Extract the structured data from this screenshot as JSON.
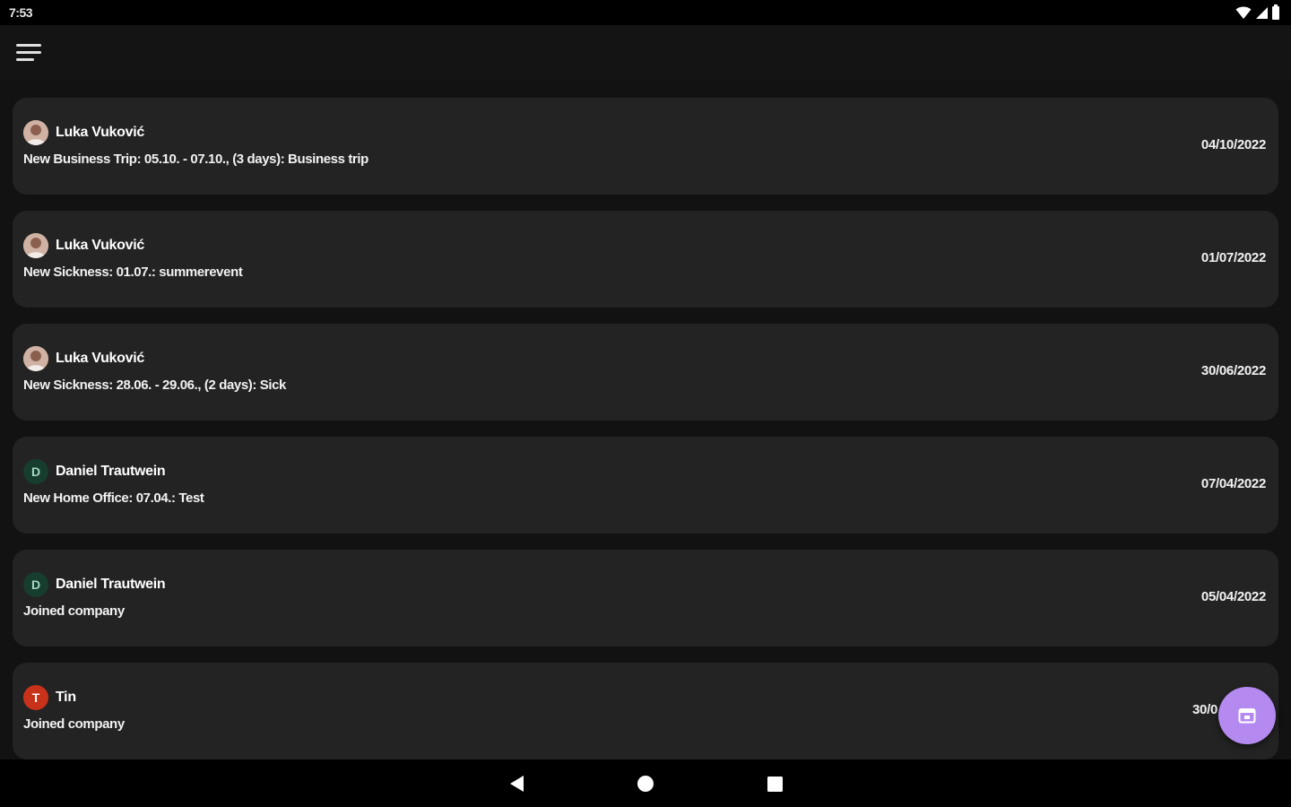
{
  "status_bar": {
    "time": "7:53",
    "icons": [
      "wifi-icon",
      "signal-icon",
      "battery-icon"
    ]
  },
  "app_bar": {
    "menu_icon": "menu-icon"
  },
  "feed": [
    {
      "name": "Luka Vuković",
      "avatar": {
        "type": "photo"
      },
      "text": "New Business Trip: 05.10. - 07.10., (3 days): Business trip",
      "date": "04/10/2022"
    },
    {
      "name": "Luka Vuković",
      "avatar": {
        "type": "photo"
      },
      "text": "New Sickness: 01.07.: summerevent",
      "date": "01/07/2022"
    },
    {
      "name": "Luka Vuković",
      "avatar": {
        "type": "photo"
      },
      "text": "New Sickness: 28.06. - 29.06., (2 days): Sick",
      "date": "30/06/2022"
    },
    {
      "name": "Daniel Trautwein",
      "avatar": {
        "type": "letter",
        "letter": "D",
        "color": "#173d2f"
      },
      "text": "New Home Office: 07.04.: Test",
      "date": "07/04/2022"
    },
    {
      "name": "Daniel Trautwein",
      "avatar": {
        "type": "letter",
        "letter": "D",
        "color": "#173d2f"
      },
      "text": "Joined company",
      "date": "05/04/2022"
    },
    {
      "name": "Tin",
      "avatar": {
        "type": "letter",
        "letter": "T",
        "color": "#c9321a"
      },
      "text": "Joined company",
      "date": "30/0"
    }
  ],
  "fab": {
    "icon": "calendar-icon",
    "color": "#b48af0"
  },
  "nav_bar": {
    "icons": [
      "back-icon",
      "home-icon",
      "recents-icon"
    ]
  }
}
